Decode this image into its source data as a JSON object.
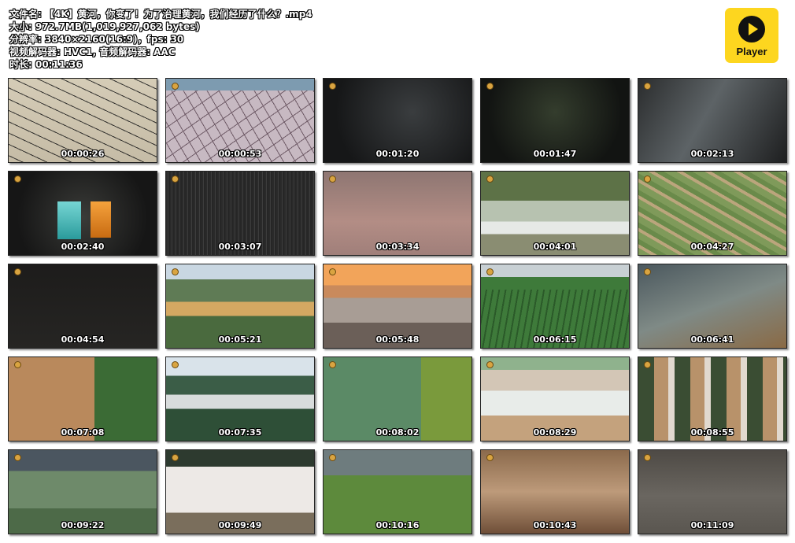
{
  "file_info": {
    "filename_line": "文件名: 【4K】黄河，你变了！为了治理黄河，我们经历了什么？.mp4",
    "size_line": "大小: 972.7MB(1,019,927,062 bytes)",
    "resolution_line": "分辨率: 3840×2160(16:9)，fps: 30",
    "codec_line": "视频解码器: HVC1, 音频解码器: AAC",
    "duration_line": "时长: 00:11:36"
  },
  "logo": {
    "label": "Player",
    "icon": "play-icon",
    "color": "#fdd61f"
  },
  "thumbnails": [
    {
      "time": "00:00:26"
    },
    {
      "time": "00:00:53"
    },
    {
      "time": "00:01:20"
    },
    {
      "time": "00:01:47"
    },
    {
      "time": "00:02:13"
    },
    {
      "time": "00:02:40"
    },
    {
      "time": "00:03:07"
    },
    {
      "time": "00:03:34"
    },
    {
      "time": "00:04:01"
    },
    {
      "time": "00:04:27"
    },
    {
      "time": "00:04:54"
    },
    {
      "time": "00:05:21"
    },
    {
      "time": "00:05:48"
    },
    {
      "time": "00:06:15"
    },
    {
      "time": "00:06:41"
    },
    {
      "time": "00:07:08"
    },
    {
      "time": "00:07:35"
    },
    {
      "time": "00:08:02"
    },
    {
      "time": "00:08:29"
    },
    {
      "time": "00:08:55"
    },
    {
      "time": "00:09:22"
    },
    {
      "time": "00:09:49"
    },
    {
      "time": "00:10:16"
    },
    {
      "time": "00:10:43"
    },
    {
      "time": "00:11:09"
    }
  ]
}
